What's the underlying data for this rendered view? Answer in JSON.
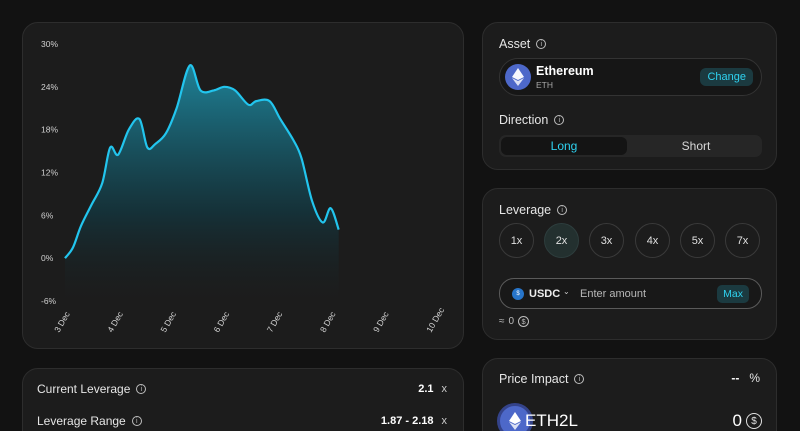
{
  "chart_data": {
    "type": "area",
    "x": [
      "3 Dec",
      "4 Dec",
      "5 Dec",
      "6 Dec",
      "7 Dec",
      "8 Dec",
      "9 Dec",
      "10 Dec"
    ],
    "y_ticks": [
      "30%",
      "24%",
      "18%",
      "12%",
      "6%",
      "0%",
      "-6%"
    ],
    "ylim": [
      -6,
      30
    ],
    "series": [
      {
        "points": [
          [
            0,
            0
          ],
          [
            0.15,
            1.5
          ],
          [
            0.3,
            4.5
          ],
          [
            0.5,
            7.5
          ],
          [
            0.7,
            10.5
          ],
          [
            0.85,
            15.5
          ],
          [
            1.0,
            14.5
          ],
          [
            1.2,
            18
          ],
          [
            1.4,
            19.5
          ],
          [
            1.55,
            15.5
          ],
          [
            1.7,
            16
          ],
          [
            1.9,
            17.5
          ],
          [
            2.1,
            21
          ],
          [
            2.35,
            27
          ],
          [
            2.55,
            23.5
          ],
          [
            2.8,
            23.5
          ],
          [
            3.0,
            24
          ],
          [
            3.2,
            23.5
          ],
          [
            3.45,
            21.5
          ],
          [
            3.6,
            22
          ],
          [
            3.85,
            22
          ],
          [
            4.05,
            19.5
          ],
          [
            4.3,
            16.5
          ],
          [
            4.45,
            14
          ],
          [
            4.65,
            8
          ],
          [
            4.85,
            5
          ],
          [
            5.0,
            7
          ],
          [
            5.15,
            4
          ]
        ]
      }
    ],
    "line_color": "#22c5ee"
  },
  "asset": {
    "title": "Asset",
    "name": "Ethereum",
    "ticker": "ETH",
    "change_label": "Change"
  },
  "direction": {
    "title": "Direction",
    "long_label": "Long",
    "short_label": "Short",
    "selected": "Long"
  },
  "leverage": {
    "title": "Leverage",
    "options": [
      "1x",
      "2x",
      "3x",
      "4x",
      "5x",
      "7x"
    ],
    "selected": "2x",
    "token": "USDC",
    "amount_placeholder": "Enter amount",
    "max_label": "Max",
    "approx_prefix": "≈",
    "approx_value": "0"
  },
  "current": {
    "current_leverage_label": "Current Leverage",
    "current_leverage_value": "2.1",
    "current_leverage_unit": "x",
    "leverage_range_label": "Leverage Range",
    "leverage_range_value": "1.87 - 2.18",
    "leverage_range_unit": "x"
  },
  "impact": {
    "title": "Price Impact",
    "value": "--",
    "unit": "%",
    "token_name": "ETH2L",
    "token_amount": "0"
  },
  "colors": {
    "accent": "#2fd2f0",
    "background": "#121212",
    "card": "#1c1c1c"
  }
}
